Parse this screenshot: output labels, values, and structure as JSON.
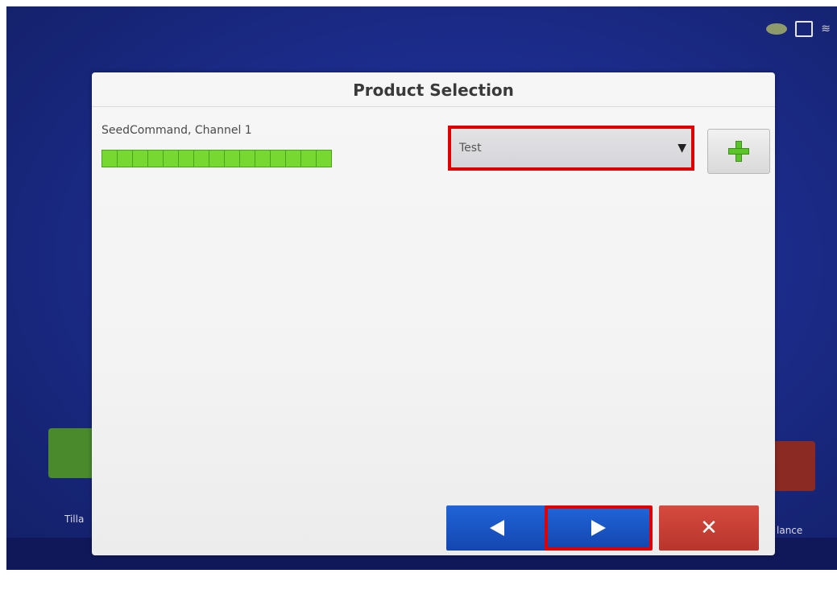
{
  "dialog": {
    "title": "Product Selection",
    "channel_label": "SeedCommand, Channel 1",
    "segment_count": 15,
    "product_select": {
      "value": "Test",
      "arrow": "▼"
    },
    "add_button": {
      "icon": "plus-icon"
    },
    "buttons": {
      "back": {
        "icon": "triangle-left-icon"
      },
      "next": {
        "icon": "triangle-right-icon"
      },
      "cancel": {
        "icon": "close-icon",
        "glyph": "✕"
      }
    }
  },
  "background": {
    "left_tile_label": "Tilla",
    "right_tile_label": "lance"
  },
  "colors": {
    "screen_blue": "#1c2c8c",
    "segment_green": "#78d832",
    "highlight_red": "#e10000",
    "nav_blue": "#1f64d8",
    "cancel_red": "#d64a3e",
    "plus_green": "#5bc42a"
  }
}
